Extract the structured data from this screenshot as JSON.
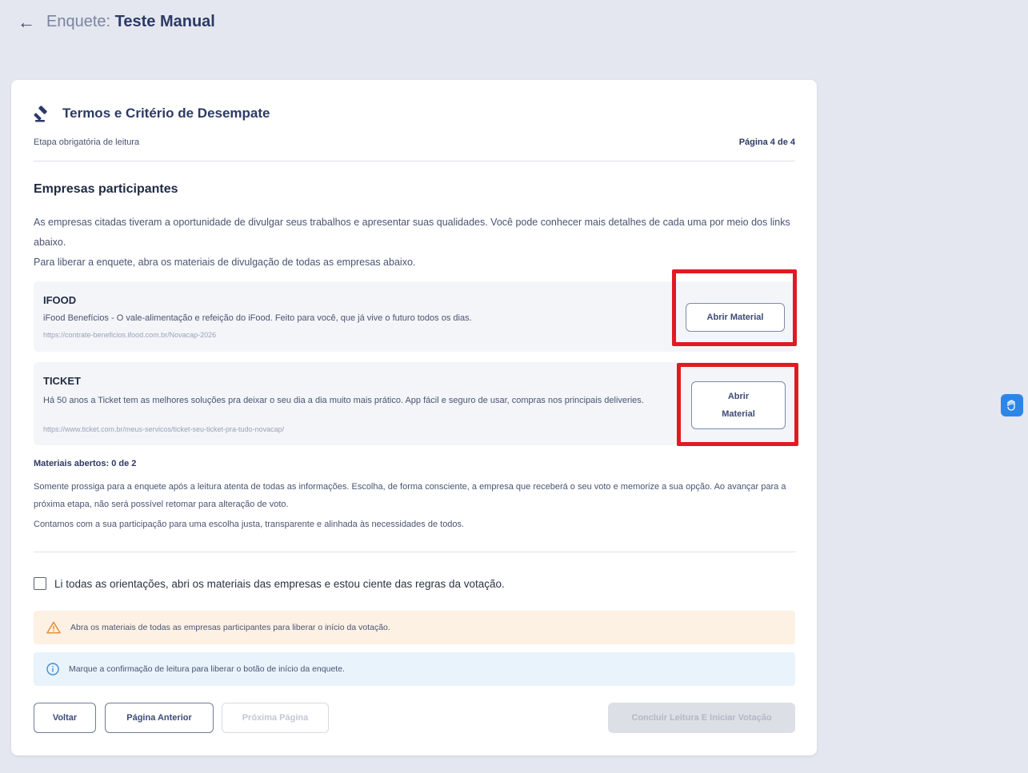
{
  "header": {
    "prefix": "Enquete:",
    "title": "Teste Manual"
  },
  "card": {
    "title": "Termos e Critério de Desempate",
    "subtitle": "Etapa obrigatória de leitura",
    "page_indicator": "Página 4 de 4"
  },
  "section": {
    "title": "Empresas participantes",
    "intro_line1": "As empresas citadas tiveram a oportunidade de divulgar seus trabalhos e apresentar suas qualidades. Você pode conhecer mais detalhes de cada uma por meio dos links abaixo.",
    "intro_line2": "Para liberar a enquete, abra os materiais de divulgação de todas as empresas abaixo."
  },
  "companies": [
    {
      "name": "IFOOD",
      "description": "iFood Benefícios - O vale-alimentação e refeição do iFood. Feito para você, que já vive o futuro todos os dias.",
      "link": "https://contrate-beneficios.ifood.com.br/Novacap-2026",
      "button_label": "Abrir Material"
    },
    {
      "name": "TICKET",
      "description": "Há 50 anos a Ticket tem as melhores soluções pra deixar o seu dia a dia muito mais prático. App fácil e seguro de usar, compras nos principais deliveries.",
      "link": "https://www.ticket.com.br/meus-servicos/ticket-seu-ticket-pra-tudo-novacap/",
      "button_label": "Abrir Material"
    }
  ],
  "materials_opened": "Materiais abertos: 0 de 2",
  "notice_text": "Somente prossiga para a enquete após a leitura atenta de todas as informações. Escolha, de forma consciente, a empresa que receberá o seu voto e memorize a sua opção. Ao avançar para a próxima etapa, não será possível retomar para alteração de voto.",
  "notice_text2": "Contamos com a sua participação para uma escolha justa, transparente e alinhada às necessidades de todos.",
  "confirmation": {
    "label": "Li todas as orientações, abri os materiais das empresas e estou ciente das regras da votação.",
    "checked": false
  },
  "alerts": {
    "warning": "Abra os materiais de todas as empresas participantes para liberar o início da votação.",
    "info": "Marque a confirmação de leitura para liberar o botão de início da enquete."
  },
  "buttons": {
    "back": "Voltar",
    "previous_page": "Página Anterior",
    "next_page": "Próxima Página",
    "finish": "Concluir Leitura E Iniciar Votação"
  },
  "colors": {
    "highlight": "#e01a24",
    "accent": "#2c3a66",
    "warning_bg": "#fdf1e4",
    "info_bg": "#e8f3fb"
  }
}
